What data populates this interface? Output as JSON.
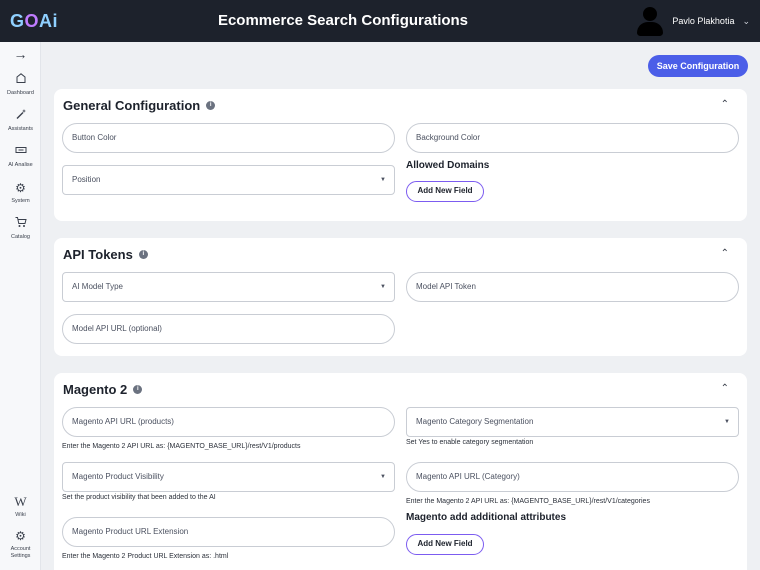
{
  "header": {
    "logo_text": "GOAi",
    "title": "Ecommerce Search Configurations",
    "user_name": "Pavlo Plakhotia"
  },
  "sidebar": {
    "items": [
      {
        "label": "",
        "icon": "arrow-right-icon"
      },
      {
        "label": "Dashboard",
        "icon": "home-icon"
      },
      {
        "label": "Assistants",
        "icon": "magic-wand-icon"
      },
      {
        "label": "AI Analise",
        "icon": "analysis-icon"
      },
      {
        "label": "System",
        "icon": "gears-icon"
      },
      {
        "label": "Catalog",
        "icon": "cart-icon"
      },
      {
        "label": "Wiki",
        "icon": "wikipedia-icon"
      },
      {
        "label": "Account Settings",
        "icon": "settings-icon"
      }
    ]
  },
  "toolbar": {
    "save_label": "Save Configuration"
  },
  "general": {
    "title": "General Configuration",
    "button_color": "Button Color",
    "background_color": "Background Color",
    "position": "Position",
    "allowed_domains": "Allowed Domains",
    "add_field": "Add New Field"
  },
  "api": {
    "title": "API Tokens",
    "model_type": "AI Model Type",
    "model_token": "Model API Token",
    "model_url": "Model API URL (optional)"
  },
  "magento": {
    "title": "Magento 2",
    "api_url_products": "Magento API URL (products)",
    "api_url_products_help": "Enter the Magento 2 API URL as: {MAGENTO_BASE_URL}/rest/V1/products",
    "category_segmentation": "Magento Category Segmentation",
    "category_segmentation_help": "Set Yes to enable category segmentation",
    "product_visibility": "Magento Product Visibility",
    "product_visibility_help": "Set the product visibility that been added to the AI",
    "api_url_category": "Magento API URL (Category)",
    "api_url_category_help": "Enter the Magento 2 API URL as: {MAGENTO_BASE_URL}/rest/V1/categories",
    "product_url_ext": "Magento Product URL Extension",
    "product_url_ext_help": "Enter the Magento 2 Product URL Extension as: .html",
    "additional_attributes": "Magento add additional attributes",
    "add_field": "Add New Field"
  },
  "colors": {
    "topbar": "#1d222c",
    "accent": "#4b5ee8",
    "button_border": "#7c5cf0"
  }
}
